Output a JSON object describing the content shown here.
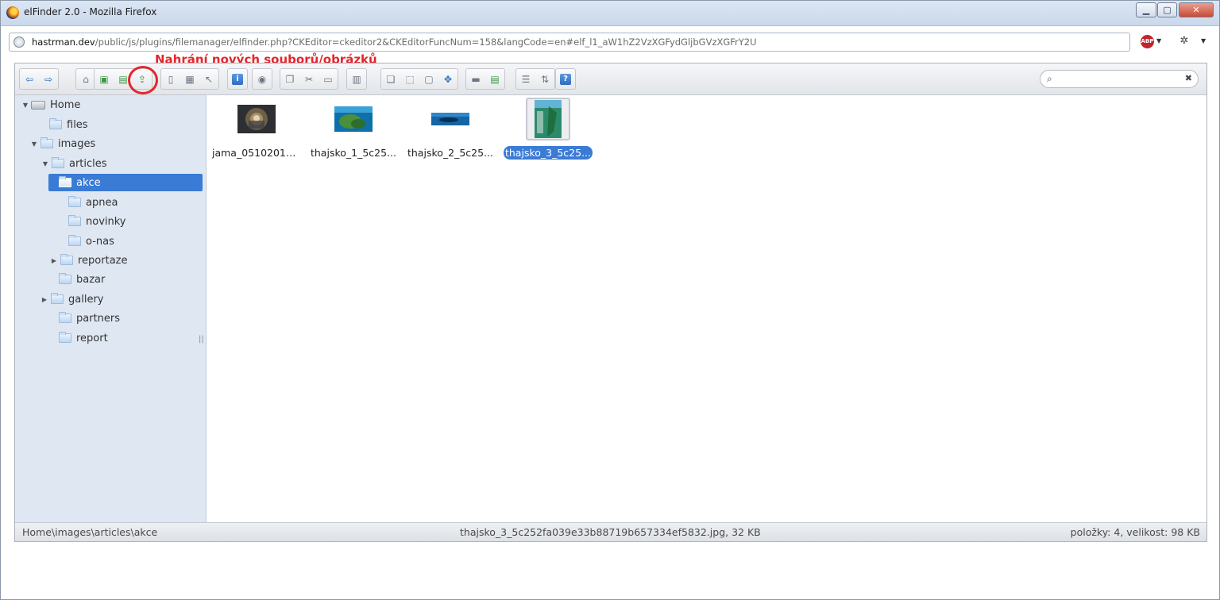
{
  "window": {
    "title": "elFinder 2.0 - Mozilla Firefox",
    "minimize": "▁",
    "maximize": "▢",
    "close": "✕"
  },
  "browser": {
    "url_host": "hastrman.dev",
    "url_path": "/public/js/plugins/filemanager/elfinder.php?CKEditor=ckeditor2&CKEditorFuncNum=158&langCode=en#elf_l1_aW1hZ2VzXGFydGljbGVzXGFrY2U",
    "abp_label": "ABP"
  },
  "annotation": {
    "text": "Nahrání nových souborů/obrázků",
    "color": "#e3262c"
  },
  "toolbar": {
    "groups": [
      {
        "buttons": [
          {
            "name": "back-icon",
            "glyph": "⇦"
          },
          {
            "name": "forward-icon",
            "glyph": "⇨"
          }
        ]
      },
      {
        "buttons": [
          {
            "name": "home-icon",
            "glyph": "⌂"
          }
        ]
      },
      {
        "buttons": [
          {
            "name": "new-folder-icon",
            "glyph": "▣"
          },
          {
            "name": "new-file-icon",
            "glyph": "▤"
          },
          {
            "name": "upload-icon",
            "glyph": "⇪"
          }
        ]
      },
      {
        "buttons": [
          {
            "name": "open-icon",
            "glyph": "▯"
          },
          {
            "name": "download-icon",
            "glyph": "▦"
          },
          {
            "name": "select-icon",
            "glyph": "↖"
          }
        ]
      },
      {
        "buttons": [
          {
            "name": "info-icon",
            "glyph": "i"
          }
        ]
      },
      {
        "buttons": [
          {
            "name": "preview-icon",
            "glyph": "◉"
          }
        ]
      },
      {
        "buttons": [
          {
            "name": "copy-icon",
            "glyph": "❐"
          },
          {
            "name": "cut-icon",
            "glyph": "✂"
          },
          {
            "name": "paste-icon",
            "glyph": "▭"
          }
        ]
      },
      {
        "buttons": [
          {
            "name": "delete-icon",
            "glyph": "▥"
          }
        ]
      },
      {
        "buttons": [
          {
            "name": "duplicate-icon",
            "glyph": "❏"
          },
          {
            "name": "rename-icon",
            "glyph": "⬚"
          },
          {
            "name": "edit-icon",
            "glyph": "▢"
          },
          {
            "name": "resize-icon",
            "glyph": "✥"
          }
        ]
      },
      {
        "buttons": [
          {
            "name": "extract-icon",
            "glyph": "▬"
          },
          {
            "name": "archive-icon",
            "glyph": "▤"
          }
        ]
      },
      {
        "buttons": [
          {
            "name": "view-list-icon",
            "glyph": "☰"
          },
          {
            "name": "sort-icon",
            "glyph": "⇅"
          }
        ]
      },
      {
        "buttons": [
          {
            "name": "help-icon",
            "glyph": "?"
          }
        ]
      }
    ],
    "search_placeholder": "",
    "search_icon": "⌕",
    "clear_icon": "✖"
  },
  "tree": [
    {
      "label": "Home",
      "arrow": "▼",
      "type": "root"
    },
    {
      "label": "files",
      "arrow": "",
      "type": "folder"
    },
    {
      "label": "images",
      "arrow": "▼",
      "type": "folder"
    },
    {
      "label": "articles",
      "arrow": "▼",
      "type": "folder"
    },
    {
      "label": "akce",
      "arrow": "",
      "type": "folder",
      "selected": true
    },
    {
      "label": "apnea",
      "arrow": "",
      "type": "folder"
    },
    {
      "label": "novinky",
      "arrow": "",
      "type": "folder"
    },
    {
      "label": "o-nas",
      "arrow": "",
      "type": "folder"
    },
    {
      "label": "reportaze",
      "arrow": "▶",
      "type": "folder"
    },
    {
      "label": "bazar",
      "arrow": "",
      "type": "folder"
    },
    {
      "label": "gallery",
      "arrow": "▶",
      "type": "folder"
    },
    {
      "label": "partners",
      "arrow": "",
      "type": "folder"
    },
    {
      "label": "report",
      "arrow": "",
      "type": "folder"
    }
  ],
  "tree_resizer": "||",
  "files": [
    {
      "name": "jama_05102013...",
      "thumb": "cave"
    },
    {
      "name": "thajsko_1_5c25...",
      "thumb": "reef"
    },
    {
      "name": "thajsko_2_5c25...",
      "thumb": "diver"
    },
    {
      "name": "thajsko_3_5c25...",
      "thumb": "poster",
      "selected": true
    }
  ],
  "status": {
    "path": "Home\\images\\articles\\akce",
    "selected": "thajsko_3_5c252fa039e33b88719b657334ef5832.jpg, 32 KB",
    "summary": "položky: 4, velikost: 98 KB"
  }
}
